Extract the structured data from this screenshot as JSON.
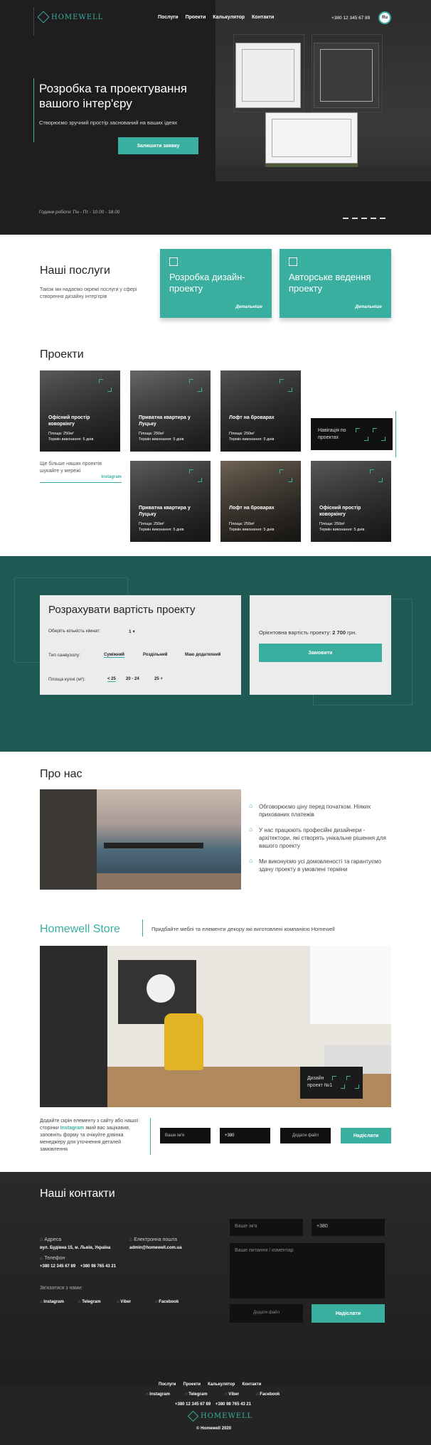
{
  "brand": {
    "name": "HOMEWELL",
    "accent": "#3aafa0"
  },
  "nav": [
    "Послуги",
    "Проекти",
    "Калькулятор",
    "Контакти"
  ],
  "header": {
    "phone": "+380 12 345 67 89",
    "lang": "Ru"
  },
  "hero": {
    "title": "Розробка та проектування вашого інтер'єру",
    "subtitle": "Створюємо зручний простір заснований на ваших ідеях",
    "cta": "Залишити заявку",
    "hours": "Години роботи: Пн - Пт - 10.00 - 18.00"
  },
  "services": {
    "title": "Наші послуги",
    "desc": "Також ми надаємо окремі послуги у сфері створення дизайну інтер'єрів",
    "cards": [
      {
        "title": "Розробка дизайн-проекту",
        "more": "Детальніше"
      },
      {
        "title": "Авторське ведення проекту",
        "more": "Детальніше"
      }
    ]
  },
  "projects": {
    "title": "Проекти",
    "instagram_text": "Ще більше наших проектів шукайте у мережі",
    "instagram_link": "Instagram",
    "nav_label": "Навігація по проектах",
    "cards": [
      {
        "title": "Офісний простір коворкінгу",
        "area": "Площа: 250м²",
        "term": "Термін виконання: 5 днів"
      },
      {
        "title": "Приватна квартира у Луцьку",
        "area": "Площа: 250м²",
        "term": "Термін виконання: 5 днів"
      },
      {
        "title": "Лофт на броварах",
        "area": "Площа: 250м²",
        "term": "Термін виконання: 5 днів"
      },
      {
        "title": "Приватна квартира у Луцьку",
        "area": "Площа: 250м²",
        "term": "Термін виконання: 5 днів"
      },
      {
        "title": "Лофт на броварах",
        "area": "Площа: 250м²",
        "term": "Термін виконання: 5 днів"
      },
      {
        "title": "Офісний простір коворкінгу",
        "area": "Площа: 250м²",
        "term": "Термін виконання: 5 днів"
      }
    ]
  },
  "calc": {
    "title": "Розрахувати вартість проекту",
    "rooms_label": "Оберіть кількість кімнат:",
    "rooms_value": "1",
    "bath_label": "Тип санвузолу:",
    "bath_opts": [
      "Суміжний",
      "Роздільний",
      "Маю додатковий"
    ],
    "kitchen_label": "Площа кухні (м²):",
    "kitchen_opts": [
      "< 25",
      "20 - 24",
      "25 +"
    ],
    "price_label": "Орієнтовна вартість проекту:",
    "price_value": "2 700",
    "price_unit": "грн.",
    "order": "Замовити"
  },
  "about": {
    "title": "Про нас",
    "points": [
      "Обговорюємо ціну перед початком. Ніяких прихованих платежів",
      "У нас працюють професійні дизайнери - архітектори, які створять унікальне рішення для вашого проекту",
      "Ми виконуємо усі домовленості та гарантуємо здачу проекту в умовлені терміни"
    ]
  },
  "store": {
    "title": "Homewell Store",
    "desc": "Придбайте меблі та елементи декору які виготовлені компанією Homewell",
    "nav_label": "Дизайн проект №1",
    "note_a": "Додайте скрін елементу з сайту або нашої сторінки",
    "note_link": "Instagram",
    "note_b": "який вас зацікавив, заповніть форму та очікуйте дзвінка менеджеру для уточнення деталей замовлення",
    "name_ph": "Ваше ім'я",
    "phone_ph": "+380",
    "file": "Додати файл",
    "send": "Надіслати"
  },
  "contacts": {
    "title": "Наші контакти",
    "address_label": "Адреса",
    "address": "вул. Будівна 15, м. Львів, Україна",
    "email_label": "Електронна пошта",
    "email": "admin@homewell.com.ua",
    "phone_label": "Телефон",
    "phones": "+380 12 345 67 89    +380 98 765 43 21",
    "connect": "Зв'язатися з нами:",
    "socials": [
      "Instagram",
      "Telegram",
      "Viber",
      "Facebook"
    ],
    "name_ph": "Ваше ім'я",
    "phone_ph": "+380",
    "msg_ph": "Ваше питання / коментар",
    "file": "Додати файл",
    "send": "Надіслати"
  },
  "footer": {
    "nav": [
      "Послуги",
      "Проекти",
      "Калькулятор",
      "Контакти"
    ],
    "socials": [
      "Instagram",
      "Telegram",
      "Viber",
      "Facebook"
    ],
    "phones": "+380 12 345 67 89    +380 98 765 43 21",
    "brand": "HOMEWELL",
    "copy": "© Homewell 2020"
  }
}
